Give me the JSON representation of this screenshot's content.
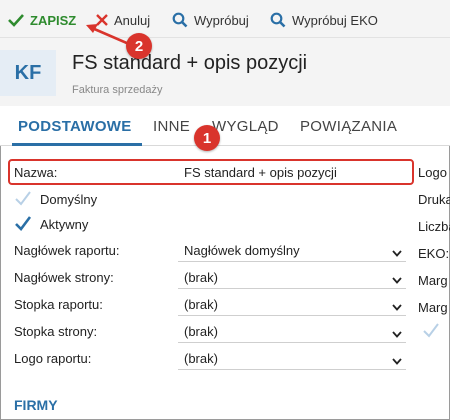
{
  "toolbar": {
    "save_label": "ZAPISZ",
    "cancel_label": "Anuluj",
    "try_label": "Wypróbuj",
    "try_eko_label": "Wypróbuj EKO"
  },
  "header": {
    "badge": "KF",
    "title": "FS standard + opis pozycji",
    "subtitle": "Faktura sprzedaży"
  },
  "tabs": [
    "PODSTAWOWE",
    "INNE",
    "WYGLĄD",
    "POWIĄZANIA"
  ],
  "form": {
    "name_label": "Nazwa:",
    "name_value": "FS standard + opis pozycji",
    "default_label": "Domyślny",
    "default_checked": false,
    "active_label": "Aktywny",
    "active_checked": true,
    "report_header_label": "Nagłówek raportu:",
    "report_header_value": "Nagłówek domyślny",
    "page_header_label": "Nagłówek strony:",
    "page_header_value": "(brak)",
    "report_footer_label": "Stopka raportu:",
    "report_footer_value": "(brak)",
    "page_footer_label": "Stopka strony:",
    "page_footer_value": "(brak)",
    "report_logo_label": "Logo raportu:",
    "report_logo_value": "(brak)"
  },
  "section_firms": "FIRMY",
  "right_column": [
    "Logo",
    "Druka",
    "Liczba",
    "EKO:",
    "Marg",
    "Marg"
  ],
  "callouts": [
    "1",
    "2"
  ],
  "colors": {
    "accent": "#2a6fa6",
    "save_green": "#2e8b2e",
    "cancel_red": "#d9342c",
    "callout_red": "#d9342c",
    "check_blue": "#2a6fa6"
  }
}
